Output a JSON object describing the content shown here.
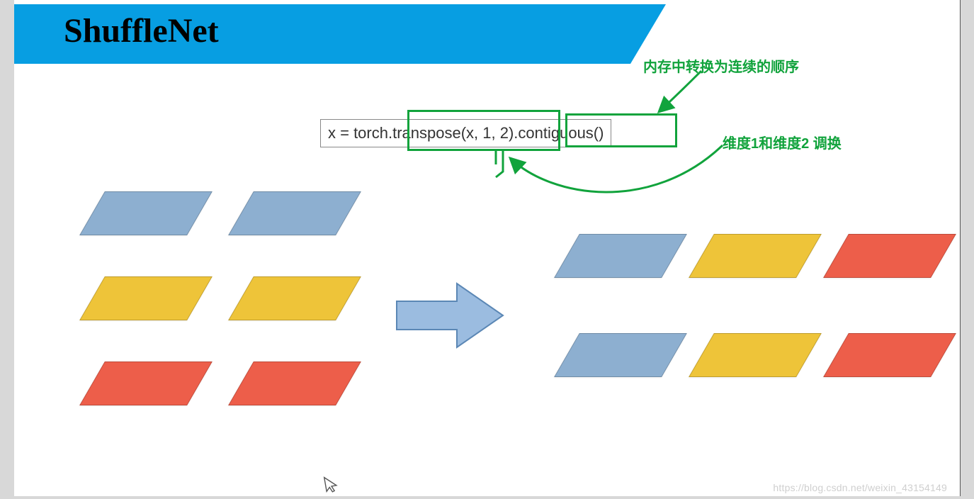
{
  "slide": {
    "title": "ShuffleNet",
    "code": "x = torch.transpose(x, 1, 2).contiguous()"
  },
  "annotations": {
    "top_right": "内存中转换为连续的顺序",
    "right": "维度1和维度2 调换"
  },
  "colors": {
    "header": "#079ee2",
    "blue": "#8dafd0",
    "yellow": "#eec439",
    "red": "#ed5e4a",
    "green": "#11a33c"
  },
  "diagram": {
    "left_grid": [
      [
        "blue",
        "blue"
      ],
      [
        "yellow",
        "yellow"
      ],
      [
        "red",
        "red"
      ]
    ],
    "right_grid": [
      [
        "blue",
        "yellow",
        "red"
      ],
      [
        "blue",
        "yellow",
        "red"
      ]
    ]
  },
  "watermark": "https://blog.csdn.net/weixin_43154149"
}
